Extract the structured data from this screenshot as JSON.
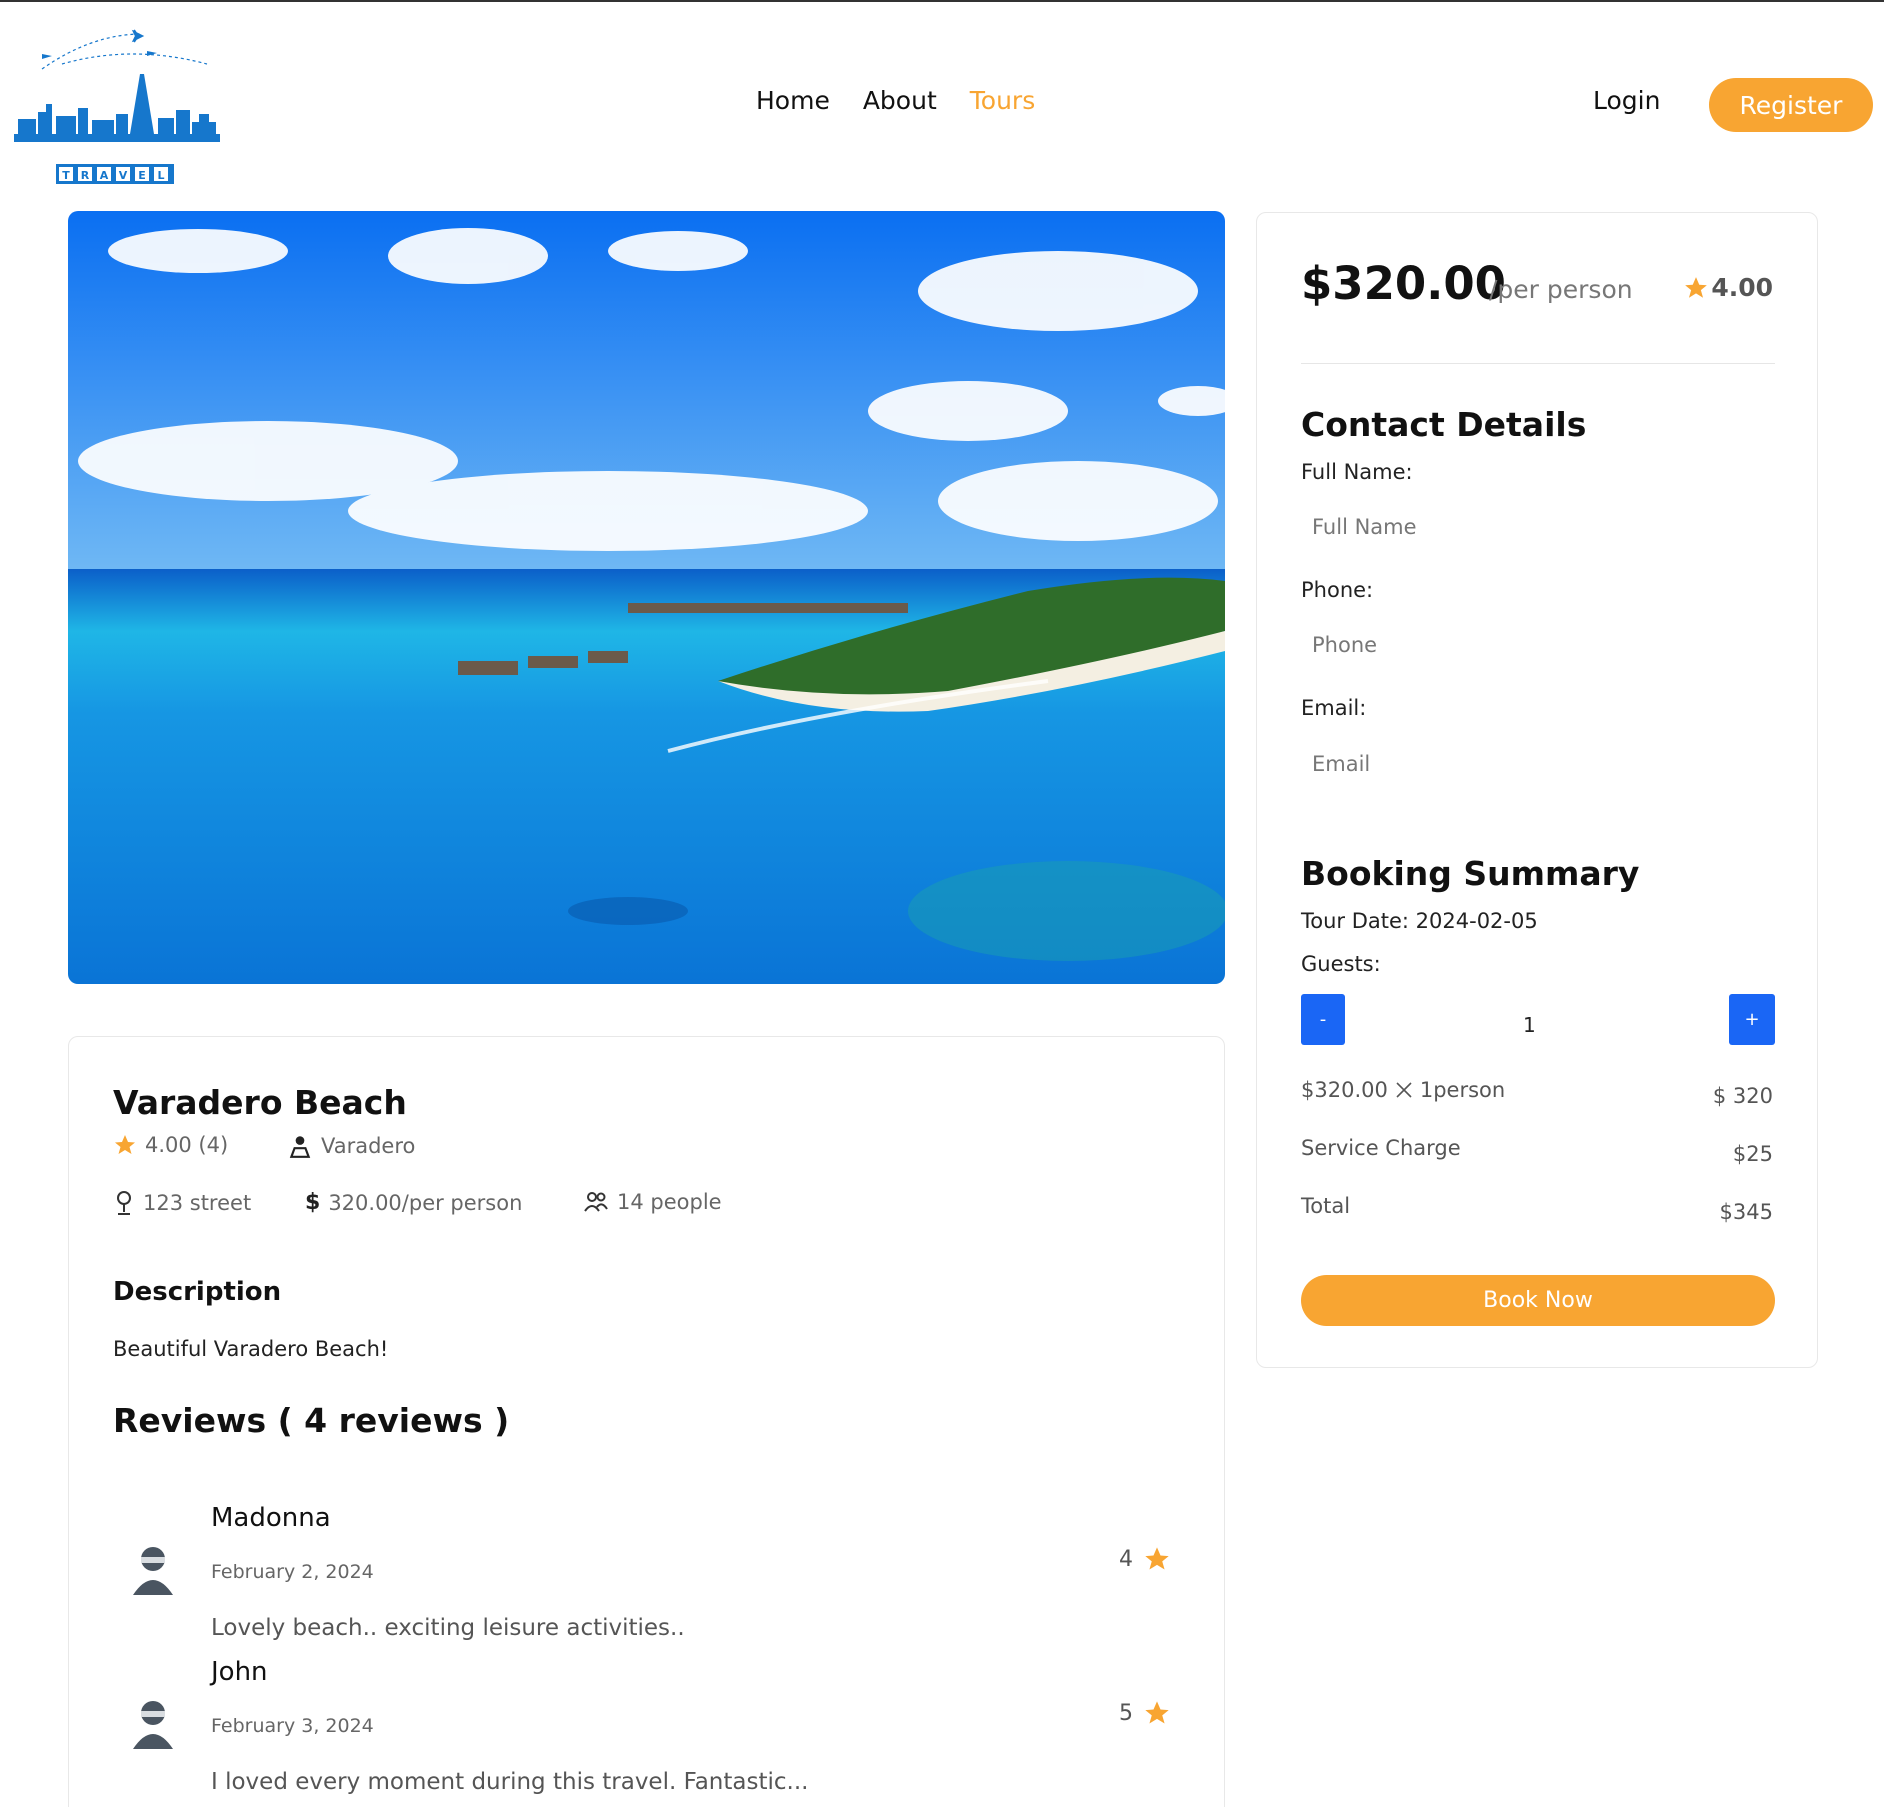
{
  "header": {
    "logo_text": "TRAVEL",
    "nav": [
      {
        "label": "Home"
      },
      {
        "label": "About"
      },
      {
        "label": "Tours"
      }
    ],
    "login_label": "Login",
    "register_label": "Register"
  },
  "tour": {
    "title": "Varadero Beach",
    "rating_text": "4.00 (4)",
    "city": "Varadero",
    "address": "123 street",
    "price_text": "320.00/per person",
    "group_size": "14 people",
    "description_heading": "Description",
    "description": "Beautiful Varadero Beach!",
    "reviews_heading": "Reviews ( 4 reviews )"
  },
  "reviews": [
    {
      "name": "Madonna",
      "date": "February 2, 2024",
      "text": "Lovely beach.. exciting leisure activities..",
      "rating": "4"
    },
    {
      "name": "John",
      "date": "February 3, 2024",
      "text": "I loved every moment during this travel. Fantastic...",
      "rating": "5"
    }
  ],
  "booking": {
    "price": "$320.00",
    "per": "/per person",
    "rating": "4.00",
    "contact_heading": "Contact Details",
    "full_name_label": "Full Name:",
    "full_name_placeholder": "Full Name",
    "phone_label": "Phone:",
    "phone_placeholder": "Phone",
    "email_label": "Email:",
    "email_placeholder": "Email",
    "summary_heading": "Booking Summary",
    "tour_date": "Tour Date: 2024-02-05",
    "guests_label": "Guests:",
    "minus_label": "-",
    "plus_label": "+",
    "guests_value": "1",
    "line_price": "$320.00",
    "line_unit": "1person",
    "line_amount": "$ 320",
    "service_label": "Service Charge",
    "service_amount": "$25",
    "total_label": "Total",
    "total_amount": "$345",
    "book_label": "Book Now"
  },
  "colors": {
    "accent": "#f8a532",
    "button_blue": "#1a66f5",
    "logo_blue": "#1677cc"
  }
}
